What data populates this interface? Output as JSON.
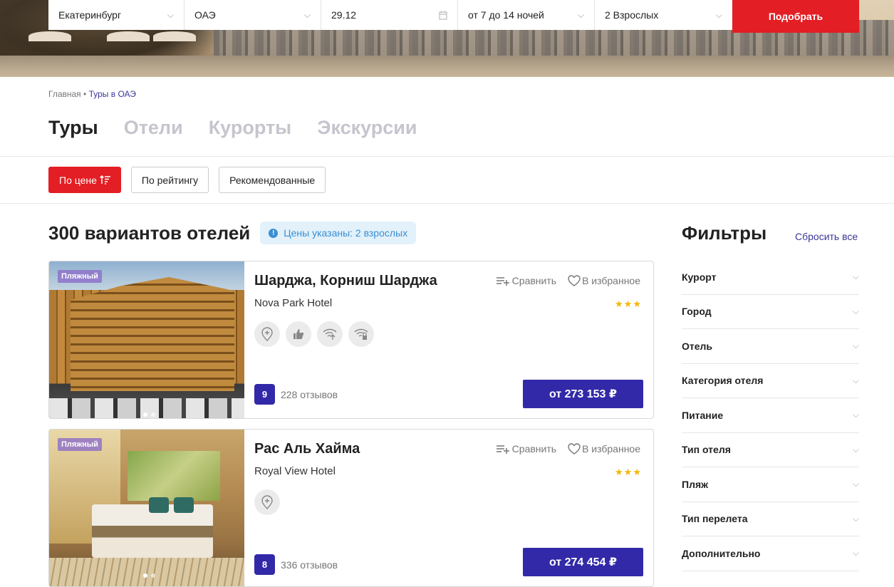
{
  "search": {
    "from": "Екатеринбург",
    "country": "ОАЭ",
    "date": "29.12",
    "nights": "от 7 до 14 ночей",
    "guests": "2 Взрослых",
    "submit": "Подобрать"
  },
  "breadcrumb": {
    "home": "Главная",
    "sep": "•",
    "current": "Туры в ОАЭ"
  },
  "tabs": [
    "Туры",
    "Отели",
    "Курорты",
    "Экскурсии"
  ],
  "sorts": [
    "По цене",
    "По рейтингу",
    "Рекомендованные"
  ],
  "results": {
    "count_text": "300 вариантов отелей",
    "note": "Цены указаны: 2 взрослых"
  },
  "card_actions": {
    "compare": "Сравнить",
    "favorite": "В избранное"
  },
  "hotels": [
    {
      "tag": "Пляжный",
      "title": "Шарджа, Корниш Шарджа",
      "hotel": "Nova Park Hotel",
      "stars": "★★★",
      "rating": "9",
      "reviews": "228 отзывов",
      "price": "от 273 153 ₽"
    },
    {
      "tag": "Пляжный",
      "title": "Рас Аль Хайма",
      "hotel": "Royal View Hotel",
      "stars": "★★★",
      "rating": "8",
      "reviews": "336 отзывов",
      "price": "от 274 454 ₽"
    }
  ],
  "filters": {
    "title": "Фильтры",
    "reset": "Сбросить все",
    "items": [
      "Курорт",
      "Город",
      "Отель",
      "Категория отеля",
      "Питание",
      "Тип отеля",
      "Пляж",
      "Тип перелета",
      "Дополнительно"
    ]
  },
  "colors": {
    "accent_red": "#e31e24",
    "accent_blue": "#3229a8",
    "link": "#3b3699",
    "star": "#f2b705"
  }
}
